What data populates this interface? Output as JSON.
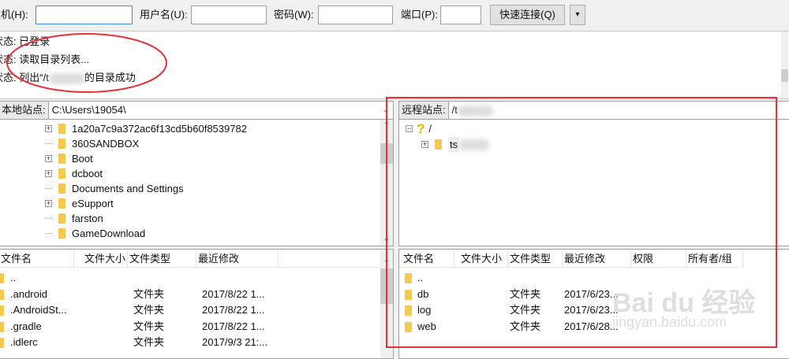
{
  "toolbar": {
    "host_label": "主机(H):",
    "host_value": "",
    "user_label": "用户名(U):",
    "user_value": "",
    "pass_label": "密码(W):",
    "pass_value": "",
    "port_label": "端口(P):",
    "port_value": "",
    "quickconnect_label": "快速连接(Q)",
    "dropdown_icon": "▾"
  },
  "log": [
    {
      "prefix": "状态:",
      "text": "已登录"
    },
    {
      "prefix": "状态:",
      "text": "读取目录列表..."
    },
    {
      "prefix": "状态:",
      "text": "列出“/t",
      "suffix": "的目录成功"
    }
  ],
  "local": {
    "site_label": "本地站点:",
    "path": "C:\\Users\\19054\\",
    "tree": [
      {
        "name": "1a20a7c9a372ac6f13cd5b60f8539782",
        "expandable": true
      },
      {
        "name": "360SANDBOX",
        "expandable": false
      },
      {
        "name": "Boot",
        "expandable": true
      },
      {
        "name": "dcboot",
        "expandable": true
      },
      {
        "name": "Documents and Settings",
        "expandable": false
      },
      {
        "name": "eSupport",
        "expandable": true
      },
      {
        "name": "farston",
        "expandable": false
      },
      {
        "name": "GameDownload",
        "expandable": false
      }
    ],
    "columns": [
      "文件名",
      "文件大小",
      "文件类型",
      "最近修改"
    ],
    "files": [
      {
        "name": "..",
        "size": "",
        "type": "",
        "modified": ""
      },
      {
        "name": ".android",
        "size": "",
        "type": "文件夹",
        "modified": "2017/8/22 1..."
      },
      {
        "name": ".AndroidSt...",
        "size": "",
        "type": "文件夹",
        "modified": "2017/8/22 1..."
      },
      {
        "name": ".gradle",
        "size": "",
        "type": "文件夹",
        "modified": "2017/8/22 1..."
      },
      {
        "name": ".idlerc",
        "size": "",
        "type": "文件夹",
        "modified": "2017/9/3 21:..."
      }
    ]
  },
  "remote": {
    "site_label": "远程站点:",
    "path": "/t",
    "tree": [
      {
        "name": "/"
      },
      {
        "name": "ts"
      }
    ],
    "columns": [
      "文件名",
      "文件大小",
      "文件类型",
      "最近修改",
      "权限",
      "所有者/组"
    ],
    "files": [
      {
        "name": "..",
        "type": "",
        "modified": ""
      },
      {
        "name": "db",
        "type": "文件夹",
        "modified": "2017/6/23..."
      },
      {
        "name": "log",
        "type": "文件夹",
        "modified": "2017/6/23..."
      },
      {
        "name": "web",
        "type": "文件夹",
        "modified": "2017/6/28..."
      }
    ]
  },
  "watermark": "Baidu经验 jingyan.baidu.com",
  "colors": {
    "annotation": "#e8303a",
    "folder": "#f5c94e"
  }
}
